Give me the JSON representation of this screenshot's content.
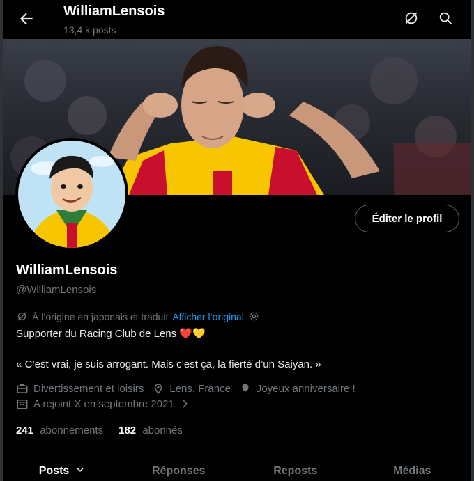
{
  "header": {
    "title": "WilliamLensois",
    "subtitle": "13,4 k posts",
    "back_icon": "arrow-left-icon",
    "grok_icon": "slashed-circle-icon",
    "search_icon": "search-icon"
  },
  "profile": {
    "edit_label": "Éditer le profil",
    "name": "WilliamLensois",
    "handle": "@WilliamLensois",
    "translation_note": "À l’origine en japonais et traduit",
    "translation_link": "Afficher l’original",
    "bio_line1": "Supporter du Racing Club de Lens",
    "bio_hearts": "❤️💛",
    "bio_line2": "« C’est vrai, je suis arrogant. Mais c’est ça, la fierté d’un Saiyan. »",
    "category": "Divertissement et loisirs",
    "location": "Lens, France",
    "birthday": "Joyeux anniversaire !",
    "joined": "A rejoint X en septembre 2021"
  },
  "stats": {
    "following_count": "241",
    "following_label": "abonnements",
    "followers_count": "182",
    "followers_label": "abonnés"
  },
  "tabs": [
    {
      "label": "Posts"
    },
    {
      "label": "Réponses"
    },
    {
      "label": "Reposts"
    },
    {
      "label": "Médias"
    }
  ],
  "colors": {
    "accent": "#1d9bf0",
    "background": "#000000",
    "muted": "#71767b",
    "banner_red": "#c8102e",
    "banner_yellow": "#f7c600"
  }
}
